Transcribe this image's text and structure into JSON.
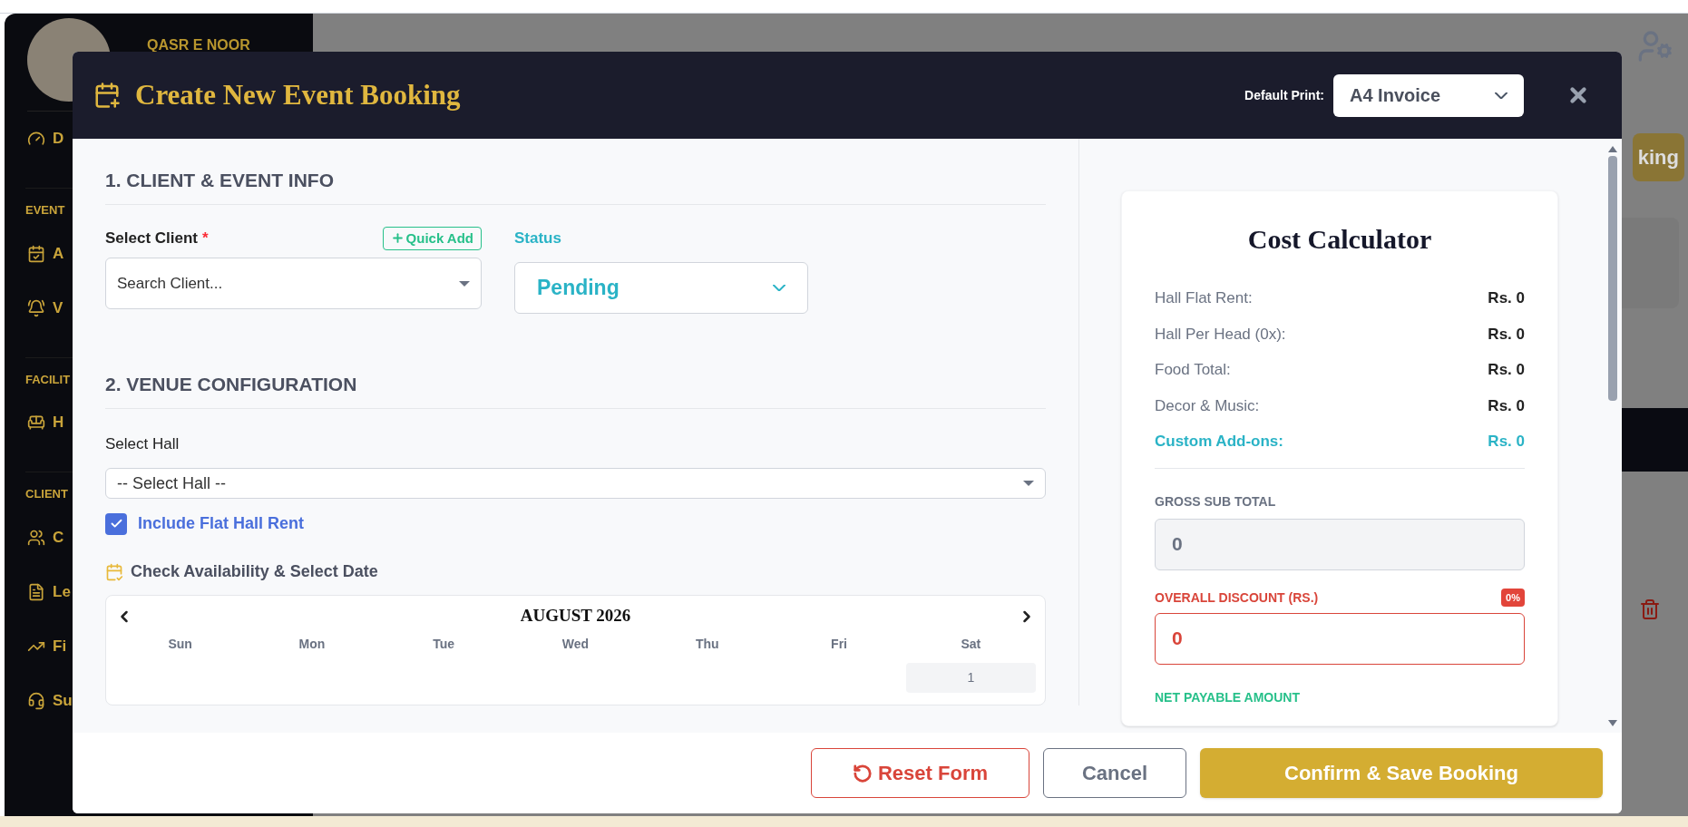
{
  "background": {
    "brand": "QASR E NOOR",
    "nav": [
      {
        "kind": "item",
        "label": "D"
      },
      {
        "kind": "section",
        "label": "EVENT"
      },
      {
        "kind": "item",
        "label": "A"
      },
      {
        "kind": "item",
        "label": "V"
      },
      {
        "kind": "section",
        "label": "FACILIT"
      },
      {
        "kind": "item",
        "label": "H"
      },
      {
        "kind": "section",
        "label": "CLIENT"
      },
      {
        "kind": "item",
        "label": "C"
      },
      {
        "kind": "item",
        "label": "Le"
      },
      {
        "kind": "item",
        "label": "Fi"
      },
      {
        "kind": "item",
        "label": "Su"
      }
    ],
    "action_button": "king"
  },
  "modal": {
    "title": "Create New Event Booking",
    "default_print_label": "Default Print:",
    "default_print": "A4 Invoice",
    "client_section": {
      "heading": "1. CLIENT & EVENT INFO",
      "client_label": "Select Client",
      "required_mark": "*",
      "quick_add": "Quick Add",
      "client_placeholder": "Search Client...",
      "status_label": "Status",
      "status": "Pending"
    },
    "venue_section": {
      "heading": "2. VENUE CONFIGURATION",
      "hall_label": "Select Hall",
      "hall_value": "-- Select Hall --",
      "flat_rent": {
        "label": "Include Flat Hall Rent",
        "checked": true
      },
      "availability_label": "Check Availability & Select Date",
      "calendar": {
        "month": "AUGUST 2026",
        "weekdays": [
          "Sun",
          "Mon",
          "Tue",
          "Wed",
          "Thu",
          "Fri",
          "Sat"
        ],
        "first_row": [
          {
            "label": "1"
          }
        ]
      }
    },
    "calculator": {
      "title": "Cost Calculator",
      "rows": [
        {
          "kind": "plain",
          "label": "Hall Flat Rent:",
          "value": "Rs. 0"
        },
        {
          "kind": "plain",
          "label": "Hall Per Head (0x):",
          "value": "Rs. 0"
        },
        {
          "kind": "plain",
          "label": "Food Total:",
          "value": "Rs. 0"
        },
        {
          "kind": "plain",
          "label": "Decor & Music:",
          "value": "Rs. 0"
        },
        {
          "kind": "highlight",
          "label": "Custom Add-ons:",
          "value": "Rs. 0"
        }
      ],
      "gross_label": "GROSS SUB TOTAL",
      "gross_value": "0",
      "discount_label": "OVERALL DISCOUNT (RS.)",
      "discount_badge": "0%",
      "discount_value": "0",
      "net_label": "NET PAYABLE AMOUNT"
    },
    "footer": {
      "reset": "Reset Form",
      "cancel": "Cancel",
      "confirm": "Confirm & Save Booking"
    }
  }
}
